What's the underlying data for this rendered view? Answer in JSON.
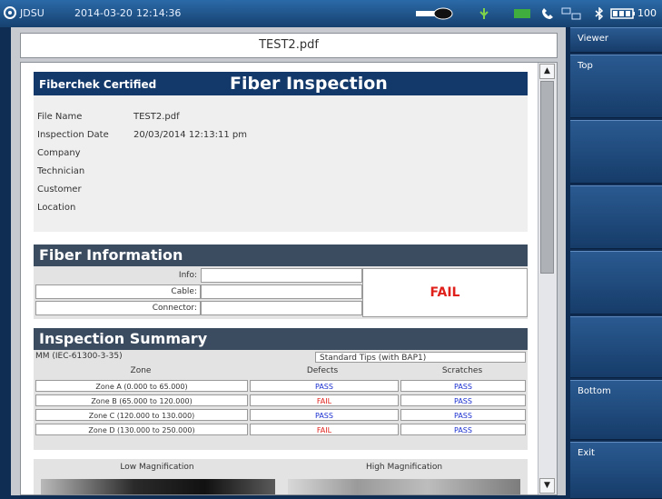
{
  "status_bar": {
    "brand": "JDSU",
    "date": "2014-03-20",
    "time": "12:14:36",
    "battery": "100"
  },
  "document": {
    "filename": "TEST2.pdf"
  },
  "report": {
    "brand": "Fiberchek Certified",
    "title": "Fiber Inspection",
    "info": [
      {
        "label": "File Name",
        "value": "TEST2.pdf"
      },
      {
        "label": "Inspection Date",
        "value": "20/03/2014 12:13:11 pm"
      },
      {
        "label": "Company",
        "value": ""
      },
      {
        "label": "Technician",
        "value": ""
      },
      {
        "label": "Customer",
        "value": ""
      },
      {
        "label": "Location",
        "value": ""
      }
    ],
    "fiber_info": {
      "title": "Fiber Information",
      "fields": [
        {
          "label": "Info:",
          "value": ""
        },
        {
          "label": "Cable:",
          "value": ""
        },
        {
          "label": "Connector:",
          "value": ""
        }
      ],
      "result": "FAIL"
    },
    "summary": {
      "title": "Inspection Summary",
      "standard": "MM (IEC-61300-3-35)",
      "tip": "Standard Tips (with BAP1)",
      "columns": [
        "Zone",
        "Defects",
        "Scratches"
      ],
      "rows": [
        {
          "zone": "Zone A (0.000 to 65.000)",
          "defects": "PASS",
          "scratches": "PASS"
        },
        {
          "zone": "Zone B (65.000 to 120.000)",
          "defects": "FAIL",
          "scratches": "PASS"
        },
        {
          "zone": "Zone C (120.000 to 130.000)",
          "defects": "PASS",
          "scratches": "PASS"
        },
        {
          "zone": "Zone D (130.000 to 250.000)",
          "defects": "FAIL",
          "scratches": "PASS"
        }
      ]
    },
    "magnification": {
      "low": "Low Magnification",
      "high": "High Magnification"
    }
  },
  "side_menu": {
    "viewer": "Viewer",
    "top": "Top",
    "bottom": "Bottom",
    "exit": "Exit"
  },
  "colors": {
    "header_navy": "#13386a",
    "section_gray": "#3b4b60",
    "fail_red": "#e0201a",
    "pass_blue": "#1a2fd0"
  }
}
